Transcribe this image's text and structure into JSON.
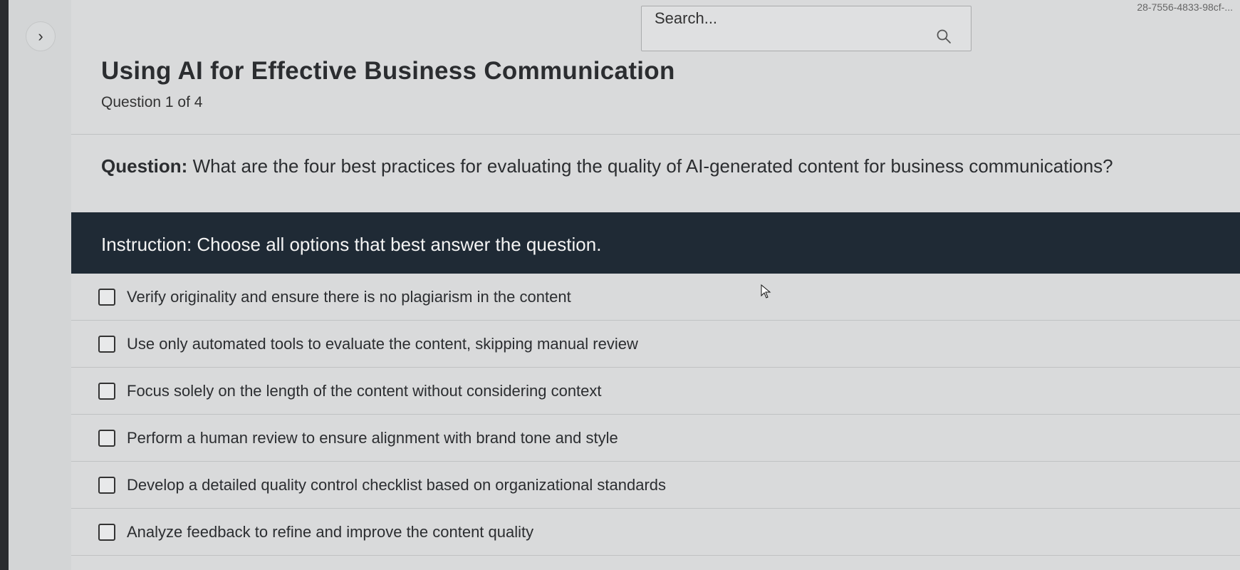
{
  "header": {
    "id_fragment": "28-7556-4833-98cf-...",
    "search_placeholder": "Search..."
  },
  "nav": {
    "expand_icon": "chevron-right-icon"
  },
  "quiz": {
    "title": "Using AI for Effective Business Communication",
    "progress": "Question 1 of 4",
    "question_label": "Question:",
    "question_text": "What are the four best practices for evaluating the quality of AI-generated content for business communications?",
    "instruction": "Instruction: Choose all options that best answer the question.",
    "options": [
      {
        "label": "Verify originality and ensure there is no plagiarism in the content",
        "checked": false
      },
      {
        "label": "Use only automated tools to evaluate the content, skipping manual review",
        "checked": false
      },
      {
        "label": "Focus solely on the length of the content without considering context",
        "checked": false
      },
      {
        "label": "Perform a human review to ensure alignment with brand tone and style",
        "checked": false
      },
      {
        "label": "Develop a detailed quality control checklist based on organizational standards",
        "checked": false
      },
      {
        "label": "Analyze feedback to refine and improve the content quality",
        "checked": false
      }
    ]
  },
  "colors": {
    "instruction_bg": "#1f2a35",
    "page_bg": "#d9dadb"
  }
}
